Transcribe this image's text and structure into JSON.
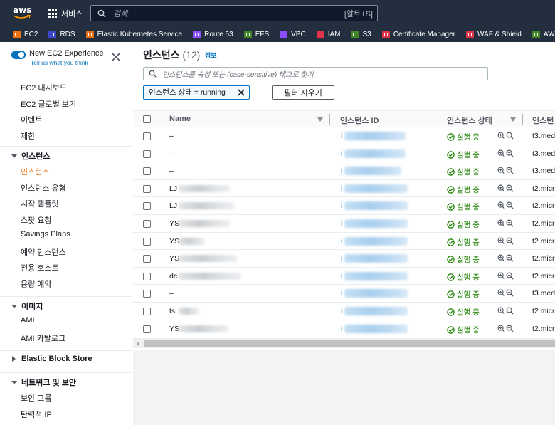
{
  "topnav": {
    "logo_text": "aws",
    "services_label": "서비스",
    "search_placeholder": "검색",
    "search_shortcut": "[알트+S]"
  },
  "favorites": [
    {
      "label": "EC2",
      "color": "#ec7211"
    },
    {
      "label": "RDS",
      "color": "#3b48cc"
    },
    {
      "label": "Elastic Kubernetes Service",
      "color": "#ec7211"
    },
    {
      "label": "Route 53",
      "color": "#8c4fff"
    },
    {
      "label": "EFS",
      "color": "#3f8624"
    },
    {
      "label": "VPC",
      "color": "#8c4fff"
    },
    {
      "label": "IAM",
      "color": "#dd344c"
    },
    {
      "label": "S3",
      "color": "#3f8624"
    },
    {
      "label": "Certificate Manager",
      "color": "#dd344c"
    },
    {
      "label": "WAF & Shield",
      "color": "#dd344c"
    },
    {
      "label": "AWS Cost Explorer",
      "color": "#3f8624"
    }
  ],
  "sidebar": {
    "new_experience_title": "New EC2 Experience",
    "new_experience_link": "Tell us what you think",
    "top_items": [
      "EC2 대시보드",
      "EC2 글로벌 보기",
      "이벤트",
      "제한"
    ],
    "sections": [
      {
        "title": "인스턴스",
        "expanded": true,
        "items": [
          "인스턴스",
          "인스턴스 유형",
          "시작 템플릿",
          "스팟 요청",
          "Savings Plans",
          "예약 인스턴스",
          "전용 호스트",
          "용량 예약"
        ],
        "active": "인스턴스"
      },
      {
        "title": "이미지",
        "expanded": true,
        "items": [
          "AMI",
          "AMI 카탈로그"
        ]
      },
      {
        "title": "Elastic Block Store",
        "expanded": false,
        "items": []
      },
      {
        "title": "네트워크 및 보안",
        "expanded": true,
        "items": [
          "보안 그룹",
          "탄력적 IP"
        ]
      }
    ]
  },
  "main": {
    "title": "인스턴스",
    "count": "(12)",
    "info_link": "정보",
    "filter_placeholder": "인스턴스를 속성 또는 (case-sensitive) 태그로 찾기",
    "filter_token": "인스턴스 상태 = running",
    "clear_filters": "필터 지우기",
    "columns": [
      "Name",
      "인스턴스 ID",
      "인스턴스 상태",
      "인스턴"
    ],
    "status_color": "#1d8102",
    "rows": [
      {
        "name": "–",
        "name_prefix": "",
        "status": "실행 중",
        "type": "t3.med"
      },
      {
        "name": "–",
        "name_prefix": "",
        "status": "실행 중",
        "type": "t3.med"
      },
      {
        "name": "–",
        "name_prefix": "",
        "status": "실행 중",
        "type": "t3.med"
      },
      {
        "name": "",
        "name_prefix": "LJ",
        "status": "실행 중",
        "type": "t2.micr"
      },
      {
        "name": "",
        "name_prefix": "LJ",
        "status": "실행 중",
        "type": "t2.micr"
      },
      {
        "name": "",
        "name_prefix": "YS",
        "status": "실행 중",
        "type": "t2.micr"
      },
      {
        "name": "",
        "name_prefix": "YS",
        "status": "실행 중",
        "type": "t2.micr"
      },
      {
        "name": "",
        "name_prefix": "YS",
        "status": "실행 중",
        "type": "t2.micr"
      },
      {
        "name": "",
        "name_prefix": "dc",
        "status": "실행 중",
        "type": "t2.micr"
      },
      {
        "name": "–",
        "name_prefix": "",
        "status": "실행 중",
        "type": "t3.med"
      },
      {
        "name": "",
        "name_prefix": "ts",
        "status": "실행 중",
        "type": "t2.micr"
      },
      {
        "name": "",
        "name_prefix": "YS",
        "status": "실행 중",
        "type": "t2.micr"
      }
    ]
  }
}
